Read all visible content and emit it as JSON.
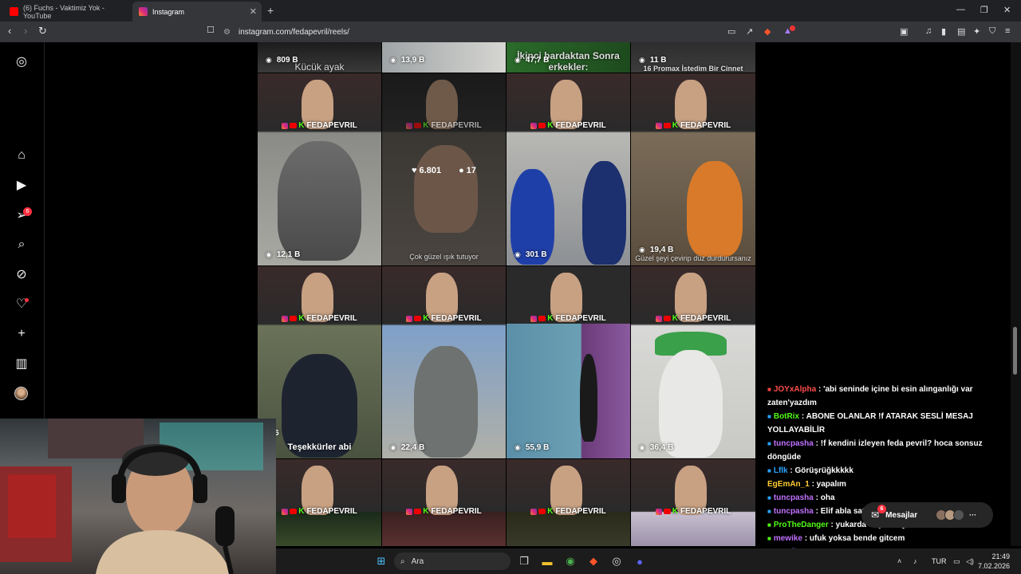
{
  "browser": {
    "tabs": [
      {
        "title": "(6) Fuchs - Vaktimiz Yok - YouTube",
        "favicon": "youtube-icon",
        "active": false
      },
      {
        "title": "Instagram",
        "favicon": "instagram-icon",
        "active": true
      }
    ],
    "new_tab_label": "+",
    "url": "instagram.com/fedapevril/reels/",
    "brave_badge_color": "#e33"
  },
  "sidebar": {
    "icons": [
      "instagram-logo-icon",
      "home-icon",
      "reels-icon",
      "direct-send-icon",
      "search-icon",
      "explore-icon",
      "notifications-heart-icon",
      "create-plus-icon",
      "dashboard-icon",
      "profile-avatar"
    ],
    "direct_badge": "6"
  },
  "grid": {
    "cells": [
      {
        "views": "809 B",
        "caption": "Kücük ayak"
      },
      {
        "views": "13,9 B",
        "caption": ""
      },
      {
        "views": "47,7 B",
        "caption": "İkinci bardaktan Sonra erkekler:"
      },
      {
        "views": "11 B",
        "caption": "16 Promax İstedim Bir Cinnet"
      },
      {
        "views": "12,1 B",
        "caption": "",
        "banner": "FEDAPEVRIL"
      },
      {
        "views": "",
        "caption": "Çok güzel ışık tutuyor",
        "banner": "FEDAPEVRIL",
        "likes": "6.801",
        "comments": "17"
      },
      {
        "views": "301 B",
        "caption": "",
        "banner": "FEDAPEVRIL"
      },
      {
        "views": "19,4 B",
        "caption": "Güzel şeyi çevirip düz durdurursanız",
        "banner": "FEDAPEVRIL"
      },
      {
        "views": "136",
        "caption": "Teşekkürler abi",
        "banner": "FEDAPEVRIL"
      },
      {
        "views": "22,4 B",
        "caption": "",
        "banner": "FEDAPEVRIL"
      },
      {
        "views": "55,9 B",
        "caption": "",
        "banner": "FEDAPEVRIL"
      },
      {
        "views": "36,4 B",
        "caption": "",
        "banner": "FEDAPEVRIL"
      },
      {
        "views": "",
        "caption": "",
        "banner": "FEDAPEVRIL"
      },
      {
        "views": "",
        "caption": "",
        "banner": "FEDAPEVRIL"
      },
      {
        "views": "",
        "caption": "",
        "banner": "FEDAPEVRIL"
      },
      {
        "views": "",
        "caption": "",
        "banner": "FEDAPEVRIL"
      }
    ]
  },
  "chat": {
    "messages": [
      {
        "user": "JOYxAlpha",
        "color": "#ff4d4d",
        "text": ": 'abi seninde içine bi esin alınganlığı var zaten'yazdım"
      },
      {
        "user": "BotRix",
        "color": "#53fc18",
        "text": ": ABONE OLANLAR !f ATARAK SESLİ MESAJ YOLLAYABİLİR"
      },
      {
        "user": "tuncpasha",
        "color": "#c071ff",
        "text": ": !f kendini izleyen feda pevril? hoca sonsuz döngüde"
      },
      {
        "user": "Lflk",
        "color": "#2aa4ff",
        "text": ": Görüşrüğkkkkk"
      },
      {
        "user": "EgEmAn_1",
        "color": "#ffcc33",
        "text": ": yapalım"
      },
      {
        "user": "tuncpasha",
        "color": "#c071ff",
        "text": ": oha"
      },
      {
        "user": "tuncpasha",
        "color": "#c071ff",
        "text": ": Elif abla sattı"
      },
      {
        "user": "ProTheDanger",
        "color": "#53fc18",
        "text": ": yukarda seçenek yok mu sıralama"
      },
      {
        "user": "mewike",
        "color": "#c071ff",
        "text": ": ufuk yoksa bende gitcem"
      },
      {
        "user": "mewike",
        "color": "#c071ff",
        "text": ":"
      }
    ]
  },
  "messages_bar": {
    "label": "Mesajlar",
    "badge": "6"
  },
  "taskbar": {
    "search_placeholder": "Ara",
    "lang": "TUR",
    "time": "21:49",
    "date": "7.02.2026"
  }
}
